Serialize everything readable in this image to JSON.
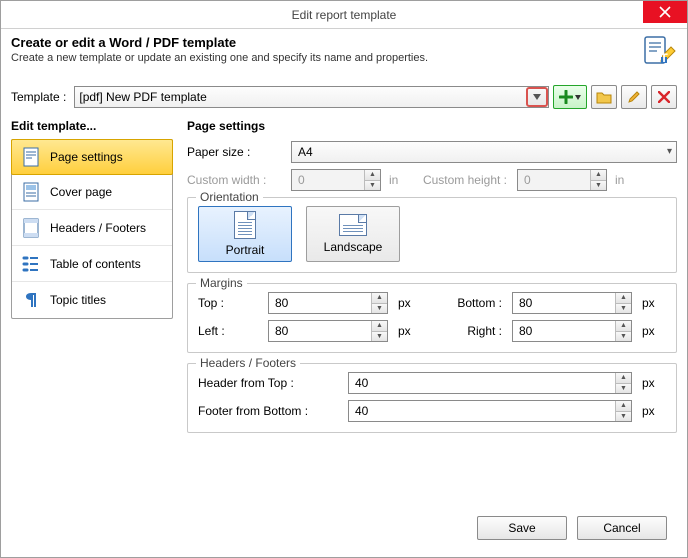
{
  "window": {
    "title": "Edit report template"
  },
  "header": {
    "title": "Create or edit a Word / PDF template",
    "description": "Create a new template or update an existing one and specify its name and properties."
  },
  "templateRow": {
    "label": "Template :",
    "value": "[pdf] New PDF template"
  },
  "sidebar": {
    "title": "Edit template...",
    "items": [
      {
        "label": "Page settings"
      },
      {
        "label": "Cover page"
      },
      {
        "label": "Headers / Footers"
      },
      {
        "label": "Table of contents"
      },
      {
        "label": "Topic titles"
      }
    ]
  },
  "page": {
    "title": "Page settings",
    "paperSizeLabel": "Paper size :",
    "paperSize": "A4",
    "customWidthLabel": "Custom width :",
    "customWidth": "0",
    "customHeightLabel": "Custom height :",
    "customHeight": "0",
    "inUnit": "in",
    "orientation": {
      "legend": "Orientation",
      "portrait": "Portrait",
      "landscape": "Landscape"
    },
    "margins": {
      "legend": "Margins",
      "topLabel": "Top :",
      "top": "80",
      "bottomLabel": "Bottom :",
      "bottom": "80",
      "leftLabel": "Left :",
      "left": "80",
      "rightLabel": "Right :",
      "right": "80",
      "unit": "px"
    },
    "hf": {
      "legend": "Headers / Footers",
      "headerLabel": "Header from Top :",
      "header": "40",
      "footerLabel": "Footer from Bottom :",
      "footer": "40",
      "unit": "px"
    }
  },
  "footer": {
    "save": "Save",
    "cancel": "Cancel"
  }
}
